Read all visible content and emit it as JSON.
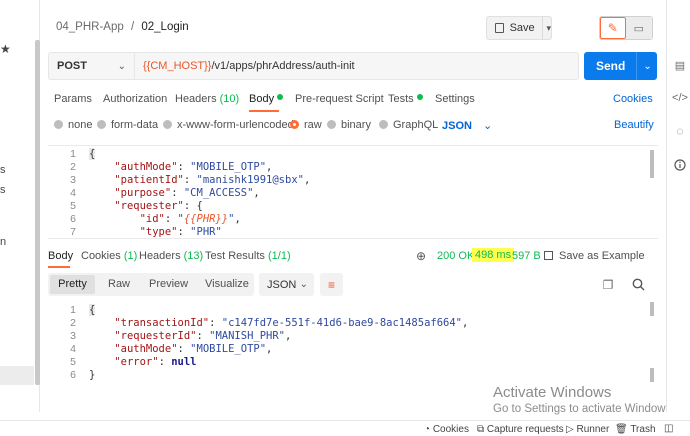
{
  "breadcrumb": {
    "collection": "04_PHR-App",
    "separator": "/",
    "request": "02_Login"
  },
  "toolbar": {
    "save_label": "Save"
  },
  "request": {
    "method": "POST",
    "url_variable": "{{CM_HOST}}",
    "url_path": "/v1/apps/phrAddress/auth-init",
    "send_label": "Send"
  },
  "tabs": {
    "params": "Params",
    "authorization": "Authorization",
    "headers": "Headers",
    "headers_count": "(10)",
    "body": "Body",
    "pre_request": "Pre-request Script",
    "tests": "Tests",
    "settings": "Settings",
    "cookies": "Cookies"
  },
  "body_types": {
    "none": "none",
    "form_data": "form-data",
    "urlencoded": "x-www-form-urlencoded",
    "raw": "raw",
    "binary": "binary",
    "graphql": "GraphQL",
    "format": "JSON",
    "beautify": "Beautify"
  },
  "request_body": {
    "line_numbers": [
      "1",
      "2",
      "3",
      "4",
      "5",
      "6",
      "7"
    ],
    "line1": "{",
    "l2_key": "\"authMode\"",
    "l2_val": "\"MOBILE_OTP\"",
    "l3_key": "\"patientId\"",
    "l3_val": "\"manishk1991@sbx\"",
    "l4_key": "\"purpose\"",
    "l4_val": "\"CM_ACCESS\"",
    "l5_key": "\"requester\"",
    "l5_rest": ": {",
    "l6_key": "\"id\"",
    "l6_q1": "\"",
    "l6_var": "{{PHR}}",
    "l6_q2": "\"",
    "l7_key": "\"type\"",
    "l7_val": "\"PHR\""
  },
  "response": {
    "tabs": {
      "body": "Body",
      "cookies": "Cookies",
      "cookies_count": "(1)",
      "headers": "Headers",
      "headers_count": "(13)",
      "test_results": "Test Results",
      "test_count": "(1/1)"
    },
    "status": "200 OK",
    "time": "498 ms",
    "size": "597 B",
    "save_example": "Save as Example",
    "views": {
      "pretty": "Pretty",
      "raw": "Raw",
      "preview": "Preview",
      "visualize": "Visualize"
    },
    "format": "JSON",
    "line_numbers": [
      "1",
      "2",
      "3",
      "4",
      "5",
      "6"
    ],
    "line1": "{",
    "l2_key": "\"transactionId\"",
    "l2_val": "\"c147fd7e-551f-41d6-bae9-8ac1485af664\"",
    "l3_key": "\"requesterId\"",
    "l3_val": "\"MANISH_PHR\"",
    "l4_key": "\"authMode\"",
    "l4_val": "\"MOBILE_OTP\"",
    "l5_key": "\"error\"",
    "l5_val": "null",
    "l6": "}"
  },
  "watermark": {
    "title": "Activate Windows",
    "subtitle": "Go to Settings to activate Windows."
  },
  "status_bar": {
    "cookies": "Cookies",
    "capture": "Capture requests",
    "runner": "Runner",
    "trash": "Trash"
  },
  "sidebar": {
    "letters": [
      "s",
      "s",
      "n"
    ]
  },
  "colors": {
    "accent": "#ff6c37",
    "send": "#097bed",
    "link": "#0265d2",
    "status_ok": "#0cbb52",
    "highlight": "#ffff4d"
  }
}
